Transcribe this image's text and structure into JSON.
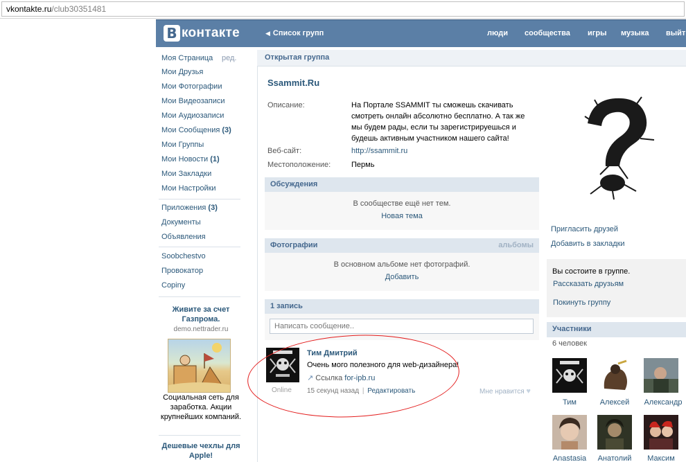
{
  "browser": {
    "url_domain": "vkontakte.ru",
    "url_path": "/club30351481"
  },
  "header": {
    "logo_letter": "В",
    "logo_text": "контакте",
    "back_link": "Список групп",
    "nav": [
      "люди",
      "сообщества",
      "игры",
      "музыка",
      "выйти"
    ]
  },
  "left_menu": {
    "items": [
      {
        "label": "Моя Страница",
        "extra": "ред."
      },
      {
        "label": "Мои Друзья"
      },
      {
        "label": "Мои Фотографии"
      },
      {
        "label": "Мои Видеозаписи"
      },
      {
        "label": "Мои Аудиозаписи"
      },
      {
        "label": "Мои Сообщения",
        "count": "(3)"
      },
      {
        "label": "Мои Группы"
      },
      {
        "label": "Мои Новости",
        "count": "(1)"
      },
      {
        "label": "Мои Закладки"
      },
      {
        "label": "Мои Настройки"
      }
    ],
    "apps": [
      {
        "label": "Приложения",
        "count": "(3)"
      },
      {
        "label": "Документы"
      },
      {
        "label": "Объявления"
      }
    ],
    "extra": [
      "Soobchestvo",
      "Провокатор",
      "Copiny"
    ]
  },
  "ad1": {
    "title": "Живите за счет Газпрома.",
    "domain": "demo.nettrader.ru",
    "text": "Социальная сеть для заработка. Акции крупнейших компаний."
  },
  "ad2": {
    "title": "Дешевые чехлы для Apple!"
  },
  "group": {
    "type_label": "Открытая группа",
    "name": "Ssammit.Ru",
    "description_label": "Описание:",
    "description": "На Портале SSAMMIT ты сможешь скачивать смотреть онлайн абсолютно бесплатно. А так же мы будем рады, если ты зарегистрируешься и будешь активным участником нашего сайта!",
    "website_label": "Веб-сайт:",
    "website": "http://ssammit.ru",
    "location_label": "Местоположение:",
    "location": "Пермь"
  },
  "discussions": {
    "title": "Обсуждения",
    "empty": "В сообществе ещё нет тем.",
    "action": "Новая тема"
  },
  "photos": {
    "title": "Фотографии",
    "right": "альбомы",
    "empty": "В основном альбоме нет фотографий.",
    "action": "Добавить"
  },
  "wall": {
    "title": "1 запись",
    "placeholder": "Написать сообщение..",
    "post": {
      "author": "Тим Дмитрий",
      "text": "Очень мого полезного для web-дизайнера!",
      "link_prefix": "Ссылка",
      "link": "for-ipb.ru",
      "online": "Online",
      "time": "15 секунд назад",
      "divider": "|",
      "edit": "Редактировать",
      "like": "Мне нравится"
    }
  },
  "right": {
    "invite": "Пригласить друзей",
    "bookmark": "Добавить в закладки",
    "member_status": "Вы состоите в группе.",
    "tell": "Рассказать друзьям",
    "leave": "Покинуть группу"
  },
  "members": {
    "title": "Участники",
    "count": "6 человек",
    "list": [
      "Тим",
      "Алексей",
      "Александр",
      "Anastasia",
      "Анатолий",
      "Максим"
    ]
  },
  "colors": {
    "header_bg": "#5b7fa6",
    "link": "#2B587A",
    "section_bg": "#dee6ee",
    "annotation": "#e31c1c"
  }
}
